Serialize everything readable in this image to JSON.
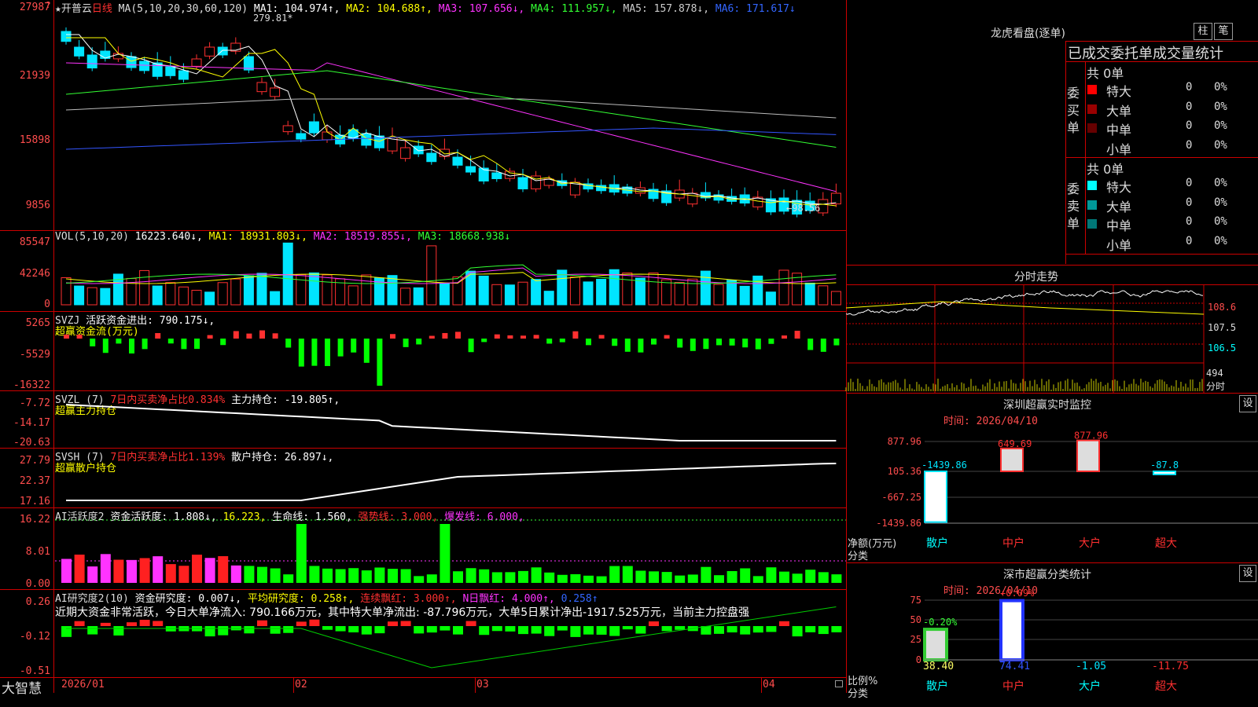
{
  "main": {
    "stock_name": "★开普云",
    "period": "日线",
    "ma_label": "MA(5,10,20,30,60,120)",
    "ma1": "MA1: 104.974↑,",
    "ma2": "MA2: 104.688↑,",
    "ma3": "MA3: 107.656↓,",
    "ma4": "MA4: 111.957↓,",
    "ma5": "MA5: 157.878↓,",
    "ma6": "MA6: 171.617↓",
    "high_mark": "279.81",
    "low_mark": "98.56",
    "y_labels": [
      "27987",
      "21939",
      "15898",
      "9856"
    ]
  },
  "vol": {
    "label": "VOL(5,10,20)",
    "value": "16223.640↓,",
    "ma1": "MA1: 18931.803↓,",
    "ma2": "MA2: 18519.855↓,",
    "ma3": "MA3: 18668.938↓",
    "y_labels": [
      "85547",
      "42246",
      "0"
    ]
  },
  "svzj": {
    "label": "SVZJ",
    "text": "活跃资金进出: 790.175↓,",
    "sub": "超赢资金流(万元)",
    "y_labels": [
      "5265",
      "-5529",
      "-16322"
    ]
  },
  "svzl": {
    "label": "SVZL (7)",
    "red": "7日内买卖净占比0.834%",
    "text": "主力持仓: -19.805↑,",
    "sub": "超赢主力持仓",
    "y_labels": [
      "-7.72",
      "-14.17",
      "-20.63"
    ]
  },
  "svsh": {
    "label": "SVSH (7)",
    "red": "7日内买卖净占比1.139%",
    "text": "散户持仓: 26.897↓,",
    "sub": "超赢散户持仓",
    "y_labels": [
      "27.79",
      "22.37",
      "17.16"
    ]
  },
  "ai1": {
    "label": "AI活跃度2",
    "a": "资金活跃度: 1.808↓,",
    "b": "16.223,",
    "c": "生命线: 1.560,",
    "d": "强势线: 3.000,",
    "e": "爆发线: 6.000,",
    "y_labels": [
      "16.22",
      "8.01",
      "0.00"
    ]
  },
  "ai2": {
    "label": "AI研究度2(10)",
    "a": "资金研究度: 0.007↓,",
    "b": "平均研究度: 0.258↑,",
    "c": "连续飘红: 3.000↑,",
    "d": "N日飘红: 4.000↑,",
    "e": "0.258↑",
    "comment": "近期大资金非常活跃，今日大单净流入: 790.166万元，其中特大单净流出: -87.796万元，大单5日累计净出-1917.525万元，当前主力控盘强",
    "y_labels": [
      "0.26",
      "-0.12",
      "-0.51"
    ]
  },
  "bottom": {
    "logo": "大智慧",
    "dates": [
      "2026/01",
      "02",
      "03",
      "04"
    ]
  },
  "right": {
    "longhu_title": "龙虎看盘(逐单)",
    "btn_zhu": "柱",
    "btn_bi": "笔",
    "header": "已成交委托单成交量统计",
    "buy_label": "委买单",
    "sell_label": "委卖单",
    "buy_total": "共 0单",
    "sell_total": "共 0单",
    "buy_rows": [
      {
        "name": "特大",
        "val": "0",
        "pct": "0%",
        "color": "#ff0000"
      },
      {
        "name": "大单",
        "val": "0",
        "pct": "0%",
        "color": "#990000"
      },
      {
        "name": "中单",
        "val": "0",
        "pct": "0%",
        "color": "#660000"
      },
      {
        "name": "小单",
        "val": "0",
        "pct": "0%",
        "color": ""
      }
    ],
    "sell_rows": [
      {
        "name": "特大",
        "val": "0",
        "pct": "0%",
        "color": "#00ffff"
      },
      {
        "name": "大单",
        "val": "0",
        "pct": "0%",
        "color": "#009999"
      },
      {
        "name": "中单",
        "val": "0",
        "pct": "0%",
        "color": "#007777"
      },
      {
        "name": "小单",
        "val": "0",
        "pct": "0%",
        "color": ""
      }
    ],
    "fenshi_title": "分时走势",
    "fenshi_prices": [
      "108.6",
      "107.5",
      "106.5"
    ],
    "fenshi_vol": "494",
    "fenshi_vol_unit": "分时",
    "monitor_title": "深圳超赢实时监控",
    "monitor_btn": "设",
    "monitor_time": "时间: 2026/04/10",
    "monitor_y": [
      "877.96",
      "105.36",
      "-667.25",
      "-1439.86"
    ],
    "monitor_axis1": "净额(万元)",
    "monitor_axis2": "分类",
    "monitor_cats": [
      "散户",
      "中户",
      "大户",
      "超大"
    ],
    "monitor_values": [
      -1439.86,
      649.69,
      877.96,
      -87.8
    ],
    "monitor_value_labels": [
      "-1439.86",
      "649.69",
      "877.96",
      "-87.8"
    ],
    "stat_title": "深市超赢分类统计",
    "stat_btn": "设",
    "stat_time": "时间: 2026/04/10",
    "stat_y": [
      "75",
      "50",
      "25",
      "0"
    ],
    "stat_axis1": "比例%",
    "stat_axis2": "分类",
    "stat_cats": [
      "散户",
      "中户",
      "大户",
      "超大"
    ],
    "stat_values": [
      38.4,
      74.41,
      -1.05,
      -11.75
    ],
    "stat_value_labels": [
      "38.40",
      "74.41",
      "-1.05",
      "-11.75"
    ],
    "stat_change_labels": [
      "-0.20%",
      "+0.09%"
    ]
  }
}
